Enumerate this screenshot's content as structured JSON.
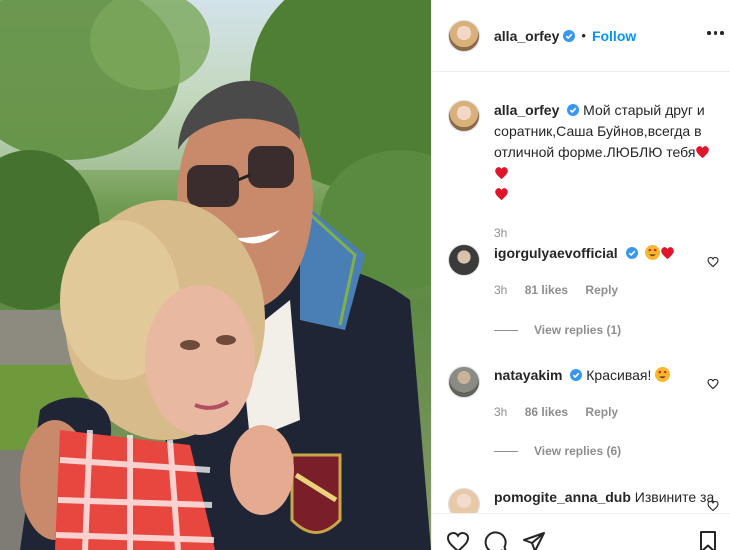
{
  "post": {
    "author": "alla_orfey",
    "follow_label": "Follow",
    "separator": "•",
    "caption": "Мой старый друг и соратник,Саша Буйнов,всегда в отличной форме.ЛЮБЛЮ тебя",
    "caption_time": "3h"
  },
  "comments": [
    {
      "user": "igorgulyaevofficial",
      "text": "",
      "time": "3h",
      "likes": "81 likes",
      "reply": "Reply",
      "replies": "View replies (1)"
    },
    {
      "user": "natayakim",
      "text": "Красивая!",
      "time": "3h",
      "likes": "86 likes",
      "reply": "Reply",
      "replies": "View replies (6)"
    },
    {
      "user": "pomogite_anna_dub",
      "text": "Извините за"
    }
  ],
  "colors": {
    "follow": "#0095f6",
    "verified": "#3897f0",
    "heart": "#e0142b",
    "meta": "#8e8e8e"
  },
  "icons": [
    "verified-badge-icon",
    "more-options-icon",
    "heart-icon",
    "comment-icon",
    "share-icon",
    "bookmark-icon",
    "heart-eyes-emoji-icon",
    "red-heart-emoji-icon"
  ]
}
